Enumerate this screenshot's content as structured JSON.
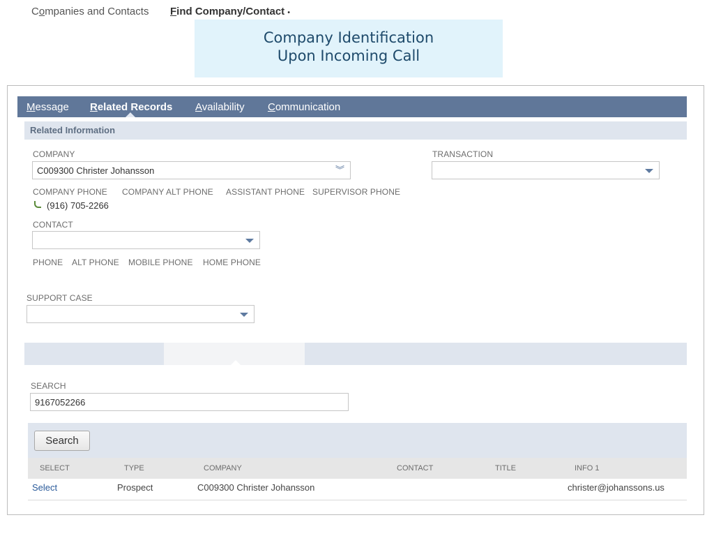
{
  "banner": {
    "line1": "Company Identification",
    "line2": "Upon Incoming Call"
  },
  "tabs": [
    {
      "u": "M",
      "rest": "essage"
    },
    {
      "u": "R",
      "rest": "elated Records"
    },
    {
      "u": "A",
      "rest": "vailability"
    },
    {
      "u": "C",
      "rest": "ommunication"
    }
  ],
  "related": {
    "header": "Related Information",
    "company_label": "COMPANY",
    "company_value": "C009300 Christer Johansson",
    "transaction_label": "TRANSACTION",
    "transaction_value": "",
    "company_phone_labels": [
      "COMPANY PHONE",
      "COMPANY ALT PHONE",
      "ASSISTANT PHONE",
      "SUPERVISOR PHONE"
    ],
    "company_phone_value": "(916) 705-2266",
    "contact_label": "CONTACT",
    "contact_value": "",
    "contact_phone_labels": [
      "PHONE",
      "ALT PHONE",
      "MOBILE PHONE",
      "HOME PHONE"
    ],
    "support_case_label": "SUPPORT CASE",
    "support_case_value": ""
  },
  "subtabs": {
    "companies_pre": "C",
    "companies_u": "o",
    "companies_rest": "mpanies and Contacts",
    "find_u": "F",
    "find_rest": "ind Company/Contact",
    "find_marker": "•"
  },
  "search": {
    "label": "SEARCH",
    "value": "9167052266",
    "button": "Search"
  },
  "table": {
    "headers": [
      "SELECT",
      "TYPE",
      "COMPANY",
      "CONTACT",
      "TITLE",
      "INFO 1"
    ],
    "rows": [
      {
        "select": "Select",
        "type": "Prospect",
        "company": "C009300 Christer Johansson",
        "contact": "",
        "title": "",
        "info1": "christer@johanssons.us"
      }
    ]
  },
  "colors": {
    "tabbar": "#607799",
    "accent": "#2a5a9a",
    "banner_bg": "#e1f3fb"
  }
}
